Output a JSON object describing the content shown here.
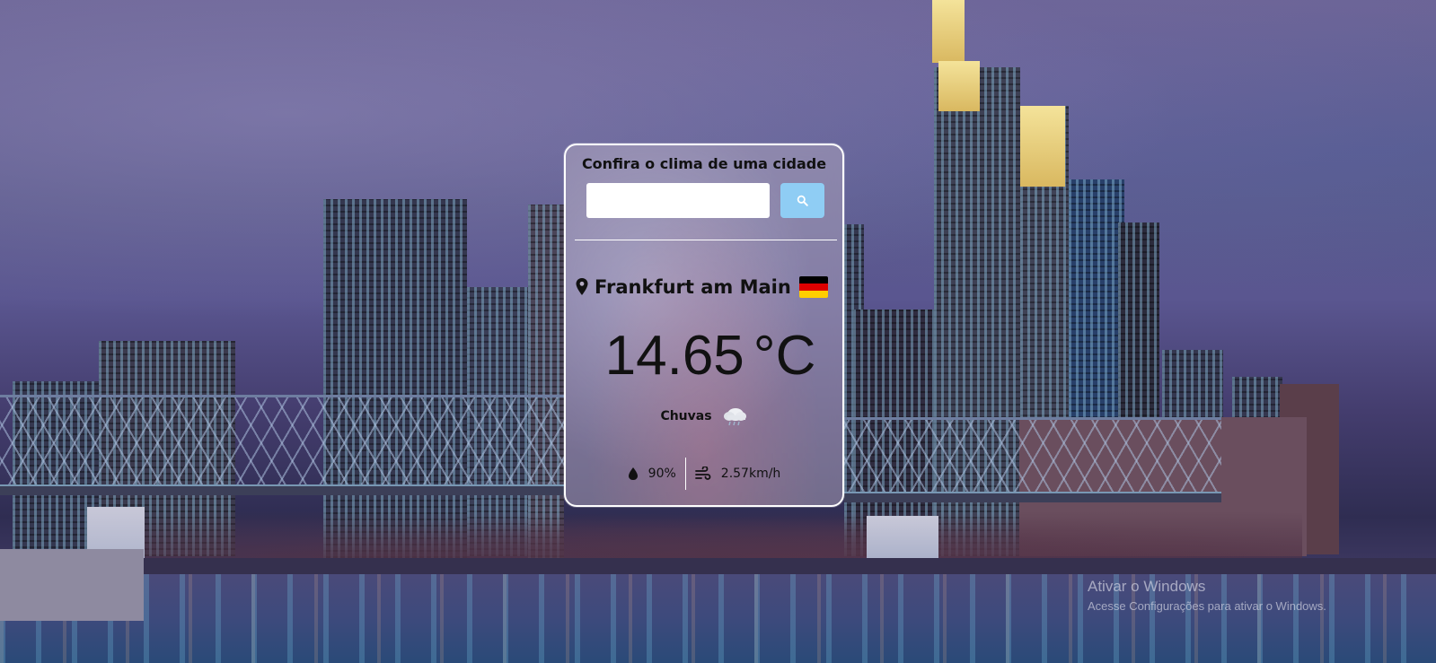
{
  "weather_card": {
    "title": "Confira o clima de uma cidade",
    "search": {
      "value": "",
      "placeholder": "",
      "button_icon": "search-icon"
    },
    "location": {
      "icon": "map-pin-icon",
      "city": "Frankfurt am Main",
      "country_flag": "germany-flag",
      "flag_colors": [
        "#000000",
        "#dd0000",
        "#ffce00"
      ]
    },
    "temperature": {
      "value": "14.65",
      "unit": "°C"
    },
    "condition": {
      "description": "Chuvas",
      "icon": "rain-cloud-icon"
    },
    "humidity": {
      "icon": "water-drop-icon",
      "value": "90%"
    },
    "wind": {
      "icon": "wind-icon",
      "value": "2.57km/h"
    }
  },
  "os_overlay": {
    "line1": "Ativar o Windows",
    "line2": "Acesse Configurações para ativar o Windows."
  },
  "colors": {
    "search_button": "#8fcdf4",
    "card_border": "#ffffff"
  }
}
